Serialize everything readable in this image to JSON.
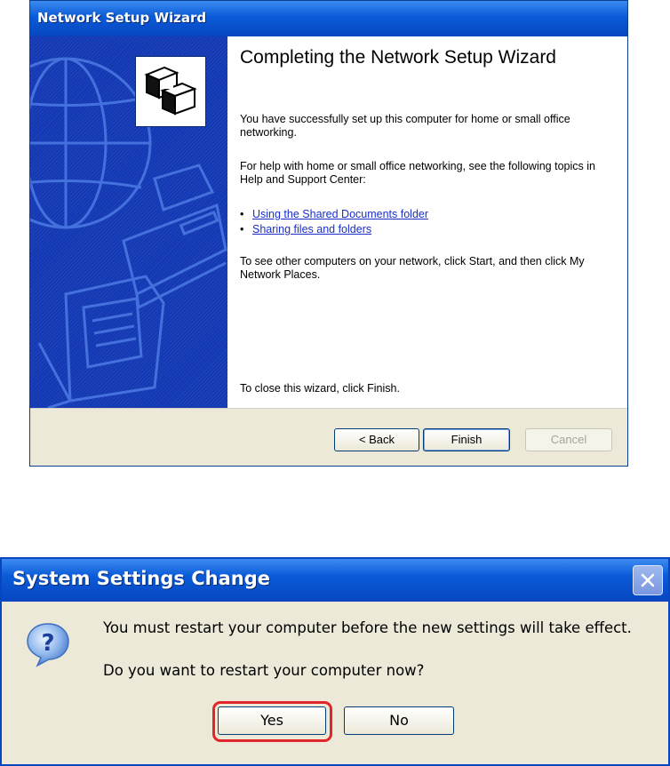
{
  "wizard": {
    "title": "Network Setup Wizard",
    "heading": "Completing the Network Setup Wizard",
    "para_success": "You have successfully set up this computer for home or small office networking.",
    "para_help": "For help with home or small office networking, see the following topics in Help and Support Center:",
    "links": [
      "Using the Shared Documents folder",
      "Sharing files and folders"
    ],
    "para_other": "To see other computers on your network, click Start, and then click My Network Places.",
    "para_close": "To close this wizard, click Finish.",
    "buttons": {
      "back": "< Back",
      "finish": "Finish",
      "cancel": "Cancel"
    }
  },
  "dialog": {
    "title": "System Settings Change",
    "message_line1": "You must restart your computer before the new settings will take effect.",
    "message_line2": "Do you want to restart your computer now?",
    "buttons": {
      "yes": "Yes",
      "no": "No"
    }
  },
  "colors": {
    "titlebar": "#0a5ad8",
    "sidebar": "#1338b4",
    "link": "#1a2ecc",
    "highlight": "#e2242b"
  },
  "icons": {
    "wizard_graphic": "network-computers-icon",
    "dialog_question": "question-icon",
    "dialog_close": "close-icon"
  }
}
